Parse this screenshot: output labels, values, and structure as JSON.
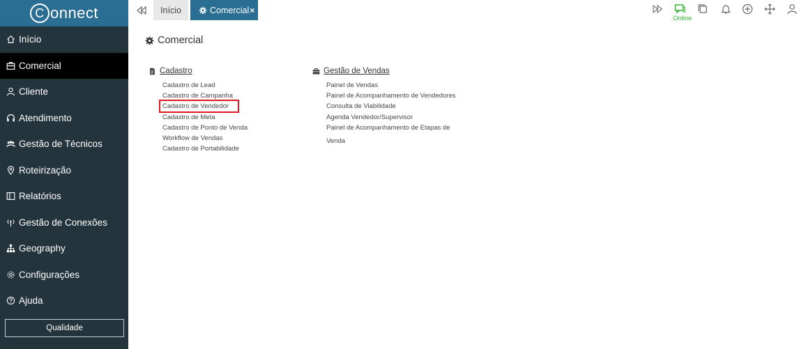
{
  "app": {
    "logo_text": "onnect",
    "logo_letter": "C"
  },
  "sidebar": {
    "items": [
      {
        "label": "Início",
        "icon": "home-icon"
      },
      {
        "label": "Comercial",
        "icon": "briefcase-icon",
        "active": true
      },
      {
        "label": "Cliente",
        "icon": "user-icon"
      },
      {
        "label": "Atendimento",
        "icon": "headset-icon"
      },
      {
        "label": "Gestão de Técnicos",
        "icon": "team-icon"
      },
      {
        "label": "Roteirização",
        "icon": "location-pin-icon"
      },
      {
        "label": "Relatórios",
        "icon": "reports-icon"
      },
      {
        "label": "Gestão de Conexões",
        "icon": "antenna-icon"
      },
      {
        "label": "Geography",
        "icon": "sitemap-icon"
      },
      {
        "label": "Configurações",
        "icon": "settings-gear-icon"
      },
      {
        "label": "Ajuda",
        "icon": "help-circle-icon"
      }
    ],
    "quality_button": "Qualidade"
  },
  "tabs": {
    "inicio": "Início",
    "comercial": "Comercial",
    "close_glyph": "×"
  },
  "header": {
    "online_label": "Online"
  },
  "content": {
    "title": "Comercial",
    "cadastro": {
      "heading": "Cadastro",
      "links": [
        "Cadastro de Lead",
        "Cadastro de Campanha",
        "Cadastro de Vendedor",
        "Cadastro de Meta",
        "Cadastro de Ponto de Venda",
        "Workflow de Vendas",
        "Cadastro de Portabilidade"
      ]
    },
    "vendas": {
      "heading": "Gestão de Vendas",
      "links": [
        "Painel de Vendas",
        "Painel de Acompanhamento de Vendedores",
        "Consulta de Viabilidade",
        "Agenda Vendedor/Supervisor",
        "Painel de Acompanhamento de Etapas de",
        "Venda"
      ]
    }
  },
  "colors": {
    "sidebar_bg": "#24343c",
    "brand_blue": "#2b6e94",
    "online_green": "#2fb52f",
    "highlight_red": "#e0181e"
  }
}
